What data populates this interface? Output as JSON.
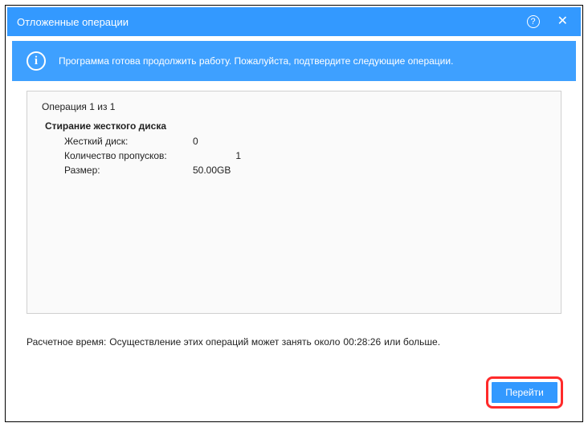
{
  "title": "Отложенные операции",
  "info_message": "Программа готова продолжить работу. Пожалуйста, подтвердите следующие операции.",
  "operation_counter": "Операция 1 из 1",
  "operation": {
    "name": "Стирание жесткого диска",
    "rows": {
      "disk_label": "Жесткий диск:",
      "disk_value": "0",
      "passes_label": "Количество пропусков:",
      "passes_value": "1",
      "size_label": "Размер:",
      "size_value": "50.00GB"
    }
  },
  "estimate": {
    "prefix": "Расчетное время:",
    "text": "Осуществление этих операций может занять около",
    "time": "00:28:26",
    "suffix": "или больше."
  },
  "buttons": {
    "go": "Перейти"
  },
  "icons": {
    "help": "?",
    "close": "✕",
    "info": "i"
  }
}
